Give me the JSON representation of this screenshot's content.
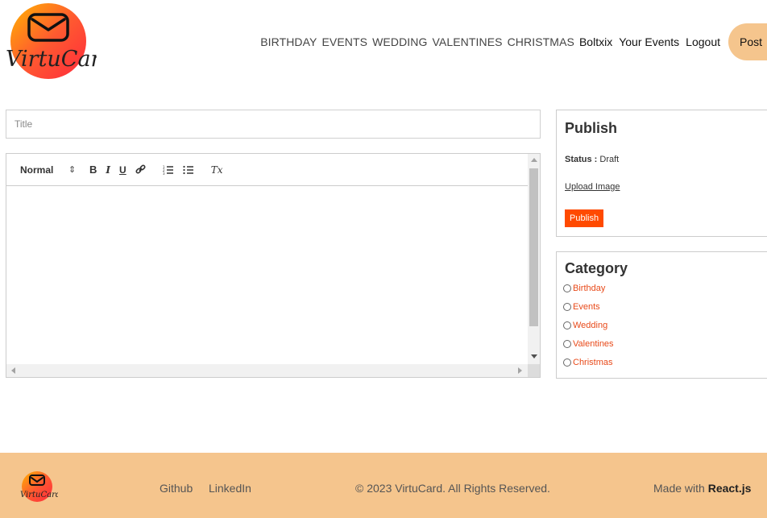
{
  "brand": {
    "name": "VirtuCard",
    "accent_color": "#f5c58d",
    "logo_gradient": [
      "#ff3030",
      "#ffb400"
    ]
  },
  "nav": {
    "links": [
      "BIRTHDAY",
      "EVENTS",
      "WEDDING",
      "VALENTINES",
      "CHRISTMAS"
    ],
    "username": "Boltxix",
    "your_events": "Your Events",
    "logout": "Logout",
    "post": "Post"
  },
  "editor": {
    "title_placeholder": "Title",
    "format_select": "Normal",
    "toolbar_icons": [
      "format-select",
      "bold-icon",
      "italic-icon",
      "underline-icon",
      "link-icon",
      "ordered-list-icon",
      "bullet-list-icon",
      "clear-format-icon"
    ],
    "bold": "B",
    "italic": "I",
    "underline": "U",
    "clear": "Tx"
  },
  "publish": {
    "title": "Publish",
    "status_label": "Status :",
    "status_value": "Draft",
    "upload_label": "Upload Image",
    "button_label": "Publish",
    "button_color": "#ff4a00"
  },
  "category": {
    "title": "Category",
    "options": [
      "Birthday",
      "Events",
      "Wedding",
      "Valentines",
      "Christmas"
    ],
    "option_color": "#e84a1a"
  },
  "footer": {
    "github": "Github",
    "linkedin": "LinkedIn",
    "copyright": "© 2023 VirtuCard. All Rights Reserved.",
    "made_with": "Made with",
    "framework": "React.js"
  }
}
